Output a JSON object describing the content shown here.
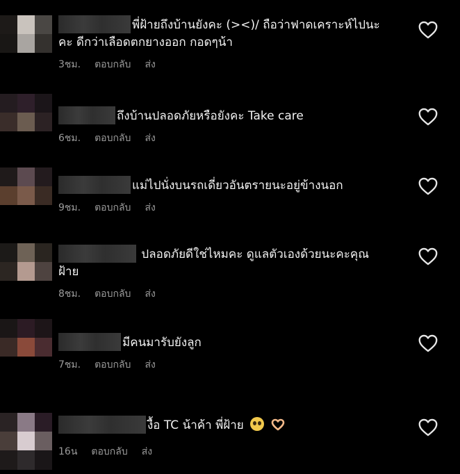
{
  "colors": {
    "background": "#000000",
    "text": "#f2f2f2",
    "meta": "#9a9a9a",
    "heart_outline": "#e6e6e6"
  },
  "comments": [
    {
      "text_line1": "พี่ฝ้ายถึงบ้านยังคะ (><)/ ถือว่าฟาดเคราะห์ไปนะ",
      "text_line2": "คะ ดีกว่าเลือดตกยางออก กอดๆน้า",
      "time": "3ชม.",
      "reply_label": "ตอบกลับ",
      "send_label": "ส่ง",
      "heart_icon": "heart-outline-icon"
    },
    {
      "text_line1": "ถึงบ้านปลอดภัยหรือยังคะ Take care",
      "time": "6ชม.",
      "reply_label": "ตอบกลับ",
      "send_label": "ส่ง",
      "heart_icon": "heart-outline-icon"
    },
    {
      "text_line1": "แม่ไปนั่งบนรถเดี่ยวอันตรายนะอยู่ข้างนอก",
      "time": "9ชม.",
      "reply_label": "ตอบกลับ",
      "send_label": "ส่ง",
      "heart_icon": "heart-outline-icon"
    },
    {
      "text_line1": "ปลอดภัยดีใช่ไหมคะ ดูแลตัวเองด้วยนะคะคุณ",
      "text_line2": "ฝ้าย",
      "time": "8ชม.",
      "reply_label": "ตอบกลับ",
      "send_label": "ส่ง",
      "heart_icon": "heart-outline-icon"
    },
    {
      "text_line1": "มีคนมารับยังลูก",
      "time": "7ชม.",
      "reply_label": "ตอบกลับ",
      "send_label": "ส่ง",
      "heart_icon": "heart-outline-icon"
    },
    {
      "text_line1": "งื้อ TC น้าค้า พี่ฝ้าย",
      "emojis": [
        "pleading-face-icon",
        "heart-hands-icon"
      ],
      "time": "16น",
      "reply_label": "ตอบกลับ",
      "send_label": "ส่ง",
      "heart_icon": "heart-outline-icon"
    }
  ]
}
